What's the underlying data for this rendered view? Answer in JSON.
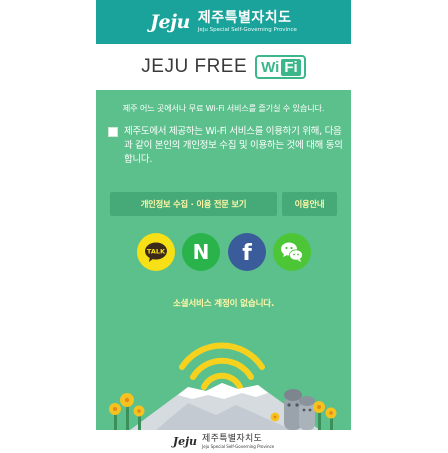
{
  "header": {
    "logo_mark": "Jeju",
    "logo_name": "제주특별자치도",
    "logo_subtitle": "Jeju Special Self-Governing Province"
  },
  "title": {
    "text": "JEJU FREE",
    "badge_wi": "Wi",
    "badge_fi": "Fi"
  },
  "content": {
    "intro": "제주 어느 곳에서나 무료 Wi-Fi 서비스를 즐기실 수 있습니다.",
    "consent_text": "제주도에서 제공하는 Wi-Fi 서비스를 이용하기 위해, 다음과 같이 본인의 개인정보 수집 및 이용하는 것에 대해 동의 합니다.",
    "privacy_button": "개인정보 수집 · 이용 전문 보기",
    "guide_button": "이용안내",
    "no_account": "소셜서비스 계정이 없습니다."
  },
  "social": {
    "kakao_label": "TALK",
    "naver_label": "N",
    "facebook_label": "f"
  },
  "footer": {
    "logo_mark": "Jeju",
    "logo_name": "제주특별자치도",
    "logo_subtitle": "Jeju Special Self-Governing Province"
  },
  "colors": {
    "header_teal": "#1aa39a",
    "background_green": "#5cc08c",
    "button_green": "#45aa77",
    "highlight_yellow": "#fff7a8",
    "kakao_yellow": "#f7e016",
    "naver_green": "#2bb34b",
    "facebook_blue": "#3b5c9b",
    "wechat_green": "#4cc637",
    "wifi_signal_yellow": "#f6d21f"
  },
  "icons": [
    "kakaotalk-icon",
    "naver-icon",
    "facebook-icon",
    "wechat-icon",
    "wifi-signal-icon",
    "checkbox-icon"
  ]
}
